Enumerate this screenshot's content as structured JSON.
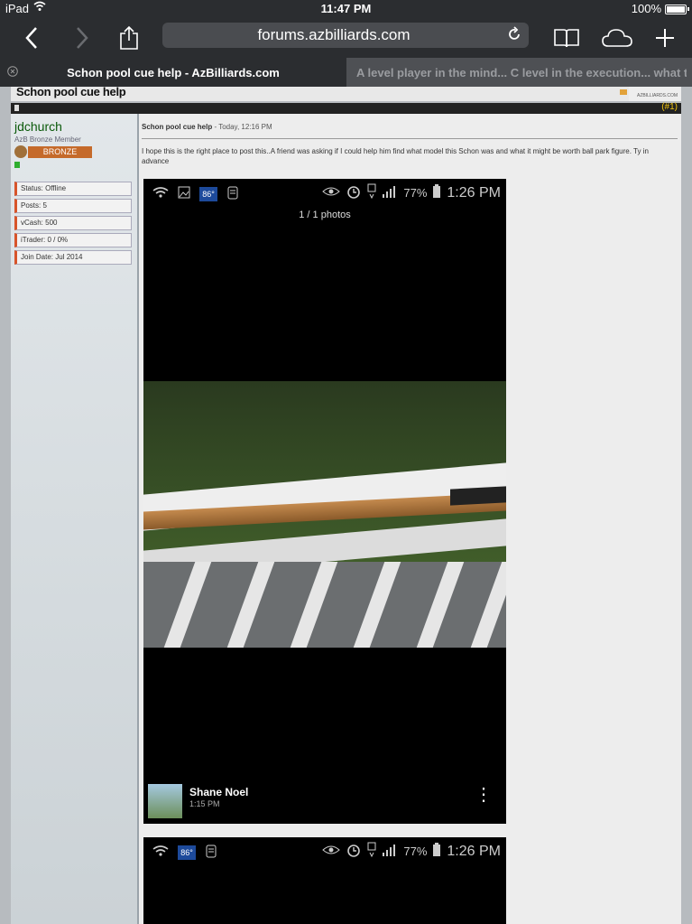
{
  "status_bar": {
    "carrier": "iPad",
    "time": "11:47 PM",
    "battery_percent": "100%"
  },
  "toolbar": {
    "url": "forums.azbilliards.com",
    "back_icon": "chevron-left-icon",
    "forward_icon": "chevron-right-icon",
    "share_icon": "share-icon",
    "bookmarks_icon": "book-icon",
    "cloud_tabs_icon": "cloud-icon",
    "new_tab_icon": "plus-icon"
  },
  "tabs": [
    {
      "label": "Schon pool cue help - AzBilliards.com",
      "active": true
    },
    {
      "label": "A level player in the mind... C level in the execution... what to...",
      "active": false
    }
  ],
  "thread": {
    "title": "Schon pool cue help",
    "logo_text": "AZBILLIARDS.COM",
    "post_number": "(#1)"
  },
  "user": {
    "name": "jdchurch",
    "title": "AzB Bronze Member",
    "rank": "BRONZE",
    "stats": [
      "Status: Offline",
      "Posts: 5",
      "vCash: 500",
      "iTrader: 0 / 0%",
      "Join Date: Jul 2014"
    ]
  },
  "post": {
    "title": "Schon pool cue help",
    "date": " - Today, 12:16 PM",
    "body": "I hope this is the right place to post this..A friend was asking if I could help him find what model this Schon was and what it might be worth ball park figure. Ty in advance"
  },
  "photo1": {
    "temp": "86°",
    "battery": "77%",
    "time": "1:26 PM",
    "count": "1 / 1 photos",
    "author": "Shane Noel",
    "author_time": "1:15 PM"
  },
  "photo2": {
    "temp": "86°",
    "battery": "77%",
    "time": "1:26 PM"
  }
}
